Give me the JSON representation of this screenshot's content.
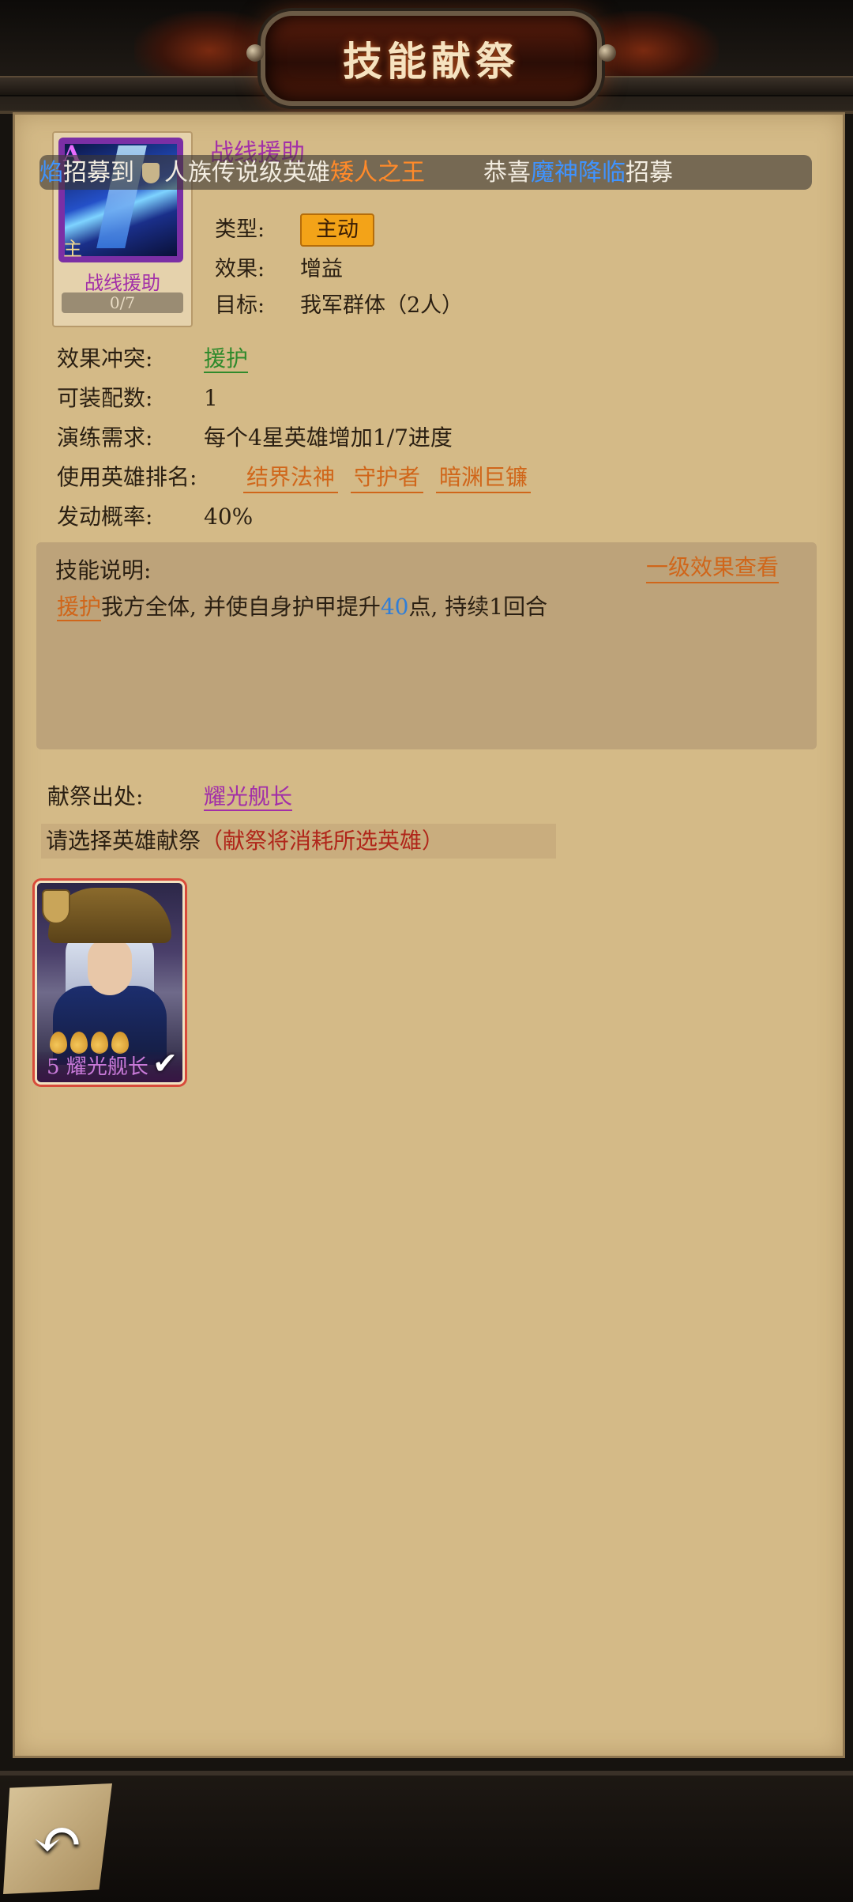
{
  "header": {
    "title": "技能献祭"
  },
  "skill": {
    "icon_grade": "A",
    "icon_tag": "主",
    "name": "战线援助",
    "card_name": "战线援助",
    "progress": "0/7",
    "title": "战线援助",
    "type_label": "类型:",
    "type_value": "主动",
    "effect_label": "效果:",
    "effect_value": "增益",
    "target_label": "目标:",
    "target_value": "我军群体（2人）"
  },
  "ticker": {
    "seg1": "焰",
    "seg2": "招募到",
    "seg3": "人族",
    "seg4": "传说级英雄",
    "seg5": "矮人之王",
    "seg6": "恭喜",
    "seg7": "魔神降临",
    "seg8": "招募"
  },
  "details": {
    "conflict_label": "效果冲突:",
    "conflict_value": "援护",
    "slots_label": "可装配数:",
    "slots_value": "1",
    "train_label": "演练需求:",
    "train_value": "每个4星英雄增加1/7进度",
    "ranking_label": "使用英雄排名:",
    "ranking": [
      "结界法神",
      "守护者",
      "暗渊巨镰"
    ],
    "chance_label": "发动概率:",
    "chance_value": "40%"
  },
  "description": {
    "header": "技能说明:",
    "level_link": "一级效果查看",
    "keyword": "援护",
    "text_a": "我方全体, 并使自身护甲提升",
    "number": "40",
    "text_b": "点, 持续1回合"
  },
  "sacrifice": {
    "source_label": "献祭出处:",
    "source_value": "耀光舰长",
    "prompt": "请选择英雄献祭",
    "warning": "（献祭将消耗所选英雄）",
    "hero": {
      "level": "5",
      "name": "耀光舰长",
      "stars": 4,
      "selected": true
    }
  },
  "footer": {
    "back_icon": "back-arrow-icon"
  }
}
